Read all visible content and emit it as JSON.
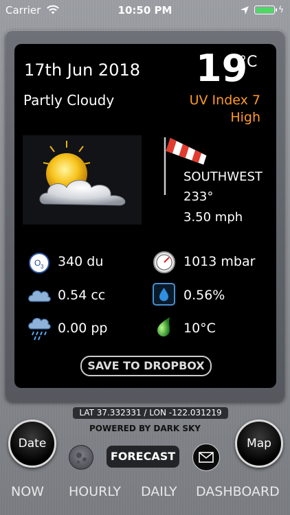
{
  "status_bar": {
    "carrier": "Carrier",
    "time": "10:50 PM"
  },
  "weather": {
    "date": "17th Jun 2018",
    "temperature": "19",
    "unit": "°C",
    "condition": "Partly Cloudy",
    "uv_line1": "UV Index 7",
    "uv_line2": "High",
    "wind_direction": "SOUTHWEST",
    "wind_degrees": "233°",
    "wind_speed": "3.50 mph"
  },
  "stats": {
    "ozone": "340 du",
    "pressure": "1013 mbar",
    "cloud_cover": "0.54 cc",
    "humidity": "0.56%",
    "precipitation": "0.00 pp",
    "dew_point": "10°C"
  },
  "actions": {
    "save_dropbox": "SAVE TO DROPBOX"
  },
  "location": {
    "latlon": "LAT 37.332331 / LON -122.031219",
    "powered_by": "POWERED BY DARK SKY"
  },
  "controls": {
    "date": "Date",
    "map": "Map",
    "forecast": "FORECAST"
  },
  "tabs": [
    "NOW",
    "HOURLY",
    "DAILY",
    "DASHBOARD"
  ],
  "icons": {
    "wifi": "wifi-icon",
    "location_arrow": "location-arrow-icon",
    "battery": "battery-icon",
    "weather": "partly-cloudy-icon",
    "windsock": "windsock-icon",
    "ozone": "ozone-icon",
    "pressure": "barometer-icon",
    "cloud": "cloud-icon",
    "humidity": "water-drop-icon",
    "rain": "rain-cloud-icon",
    "dew": "dew-drop-icon",
    "moon": "moon-icon",
    "mail": "mail-icon"
  },
  "colors": {
    "uv_text": "#ff9b21",
    "battery_fill": "#4cd964",
    "card_bg": "#000000"
  }
}
